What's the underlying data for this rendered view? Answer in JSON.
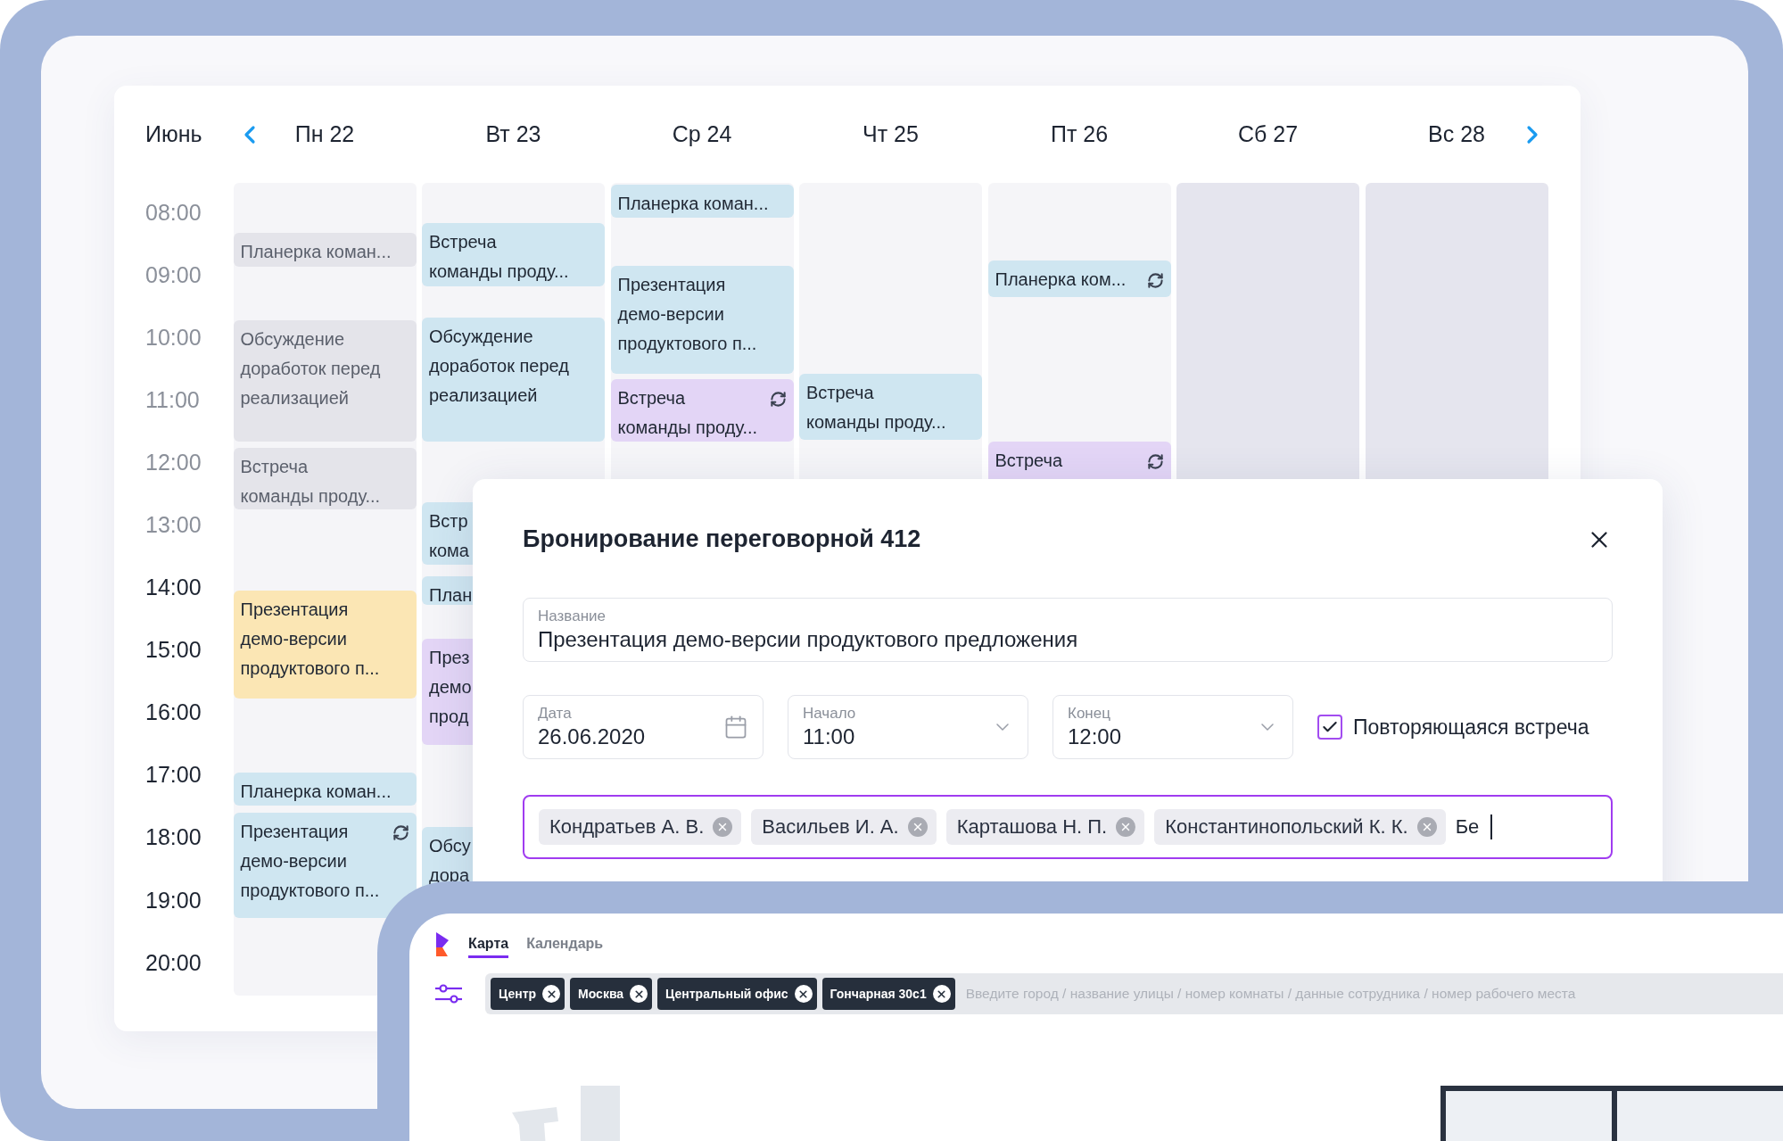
{
  "calendar": {
    "month": "Июнь",
    "days": [
      {
        "label": "Пн 22",
        "weekend": false,
        "events": [
          {
            "lines": [
              "Планерка коман..."
            ],
            "color": "#e4e4ea",
            "recurring": false
          },
          {
            "lines": [
              "Обсуждение",
              "доработок перед",
              "реализацией"
            ],
            "color": "#e4e4ea",
            "recurring": false
          },
          {
            "lines": [
              "Встреча",
              "команды проду..."
            ],
            "color": "#e4e4ea",
            "recurring": false
          },
          {
            "lines": [
              "Презентация",
              "демо-версии",
              "продуктового п..."
            ],
            "color": "#fbe6b4",
            "recurring": false
          },
          {
            "lines": [
              "Планерка коман..."
            ],
            "color": "#cfe6f1",
            "recurring": false
          },
          {
            "lines": [
              "Презентация",
              "демо-версии",
              "продуктового п..."
            ],
            "color": "#cfe6f1",
            "recurring": true
          }
        ]
      },
      {
        "label": "Вт 23",
        "weekend": false,
        "events": [
          {
            "lines": [
              "Встреча",
              "команды проду..."
            ],
            "color": "#cfe6f1",
            "recurring": false
          },
          {
            "lines": [
              "Обсуждение",
              "доработок перед",
              "реализацией"
            ],
            "color": "#cfe6f1",
            "recurring": false
          },
          {
            "lines": [
              "Встр",
              "кома"
            ],
            "color": "#cfe6f1"
          },
          {
            "lines": [
              "План"
            ],
            "color": "#cfe6f1"
          },
          {
            "lines": [
              "През",
              "демо",
              "прод"
            ],
            "color": "#e3d5f6"
          },
          {
            "lines": [
              "Обсу",
              "дора"
            ],
            "color": "#cfe6f1"
          }
        ]
      },
      {
        "label": "Ср 24",
        "weekend": false,
        "events": [
          {
            "lines": [
              "Планерка коман..."
            ],
            "color": "#cfe6f1",
            "recurring": false
          },
          {
            "lines": [
              "Презентация",
              "демо-версии",
              "продуктового п..."
            ],
            "color": "#cfe6f1",
            "recurring": false
          },
          {
            "lines": [
              "Встреча",
              "команды проду..."
            ],
            "color": "#e3d5f6",
            "recurring": true
          }
        ]
      },
      {
        "label": "Чт 25",
        "weekend": false,
        "events": [
          {
            "lines": [
              "Встреча",
              "команды проду..."
            ],
            "color": "#cfe6f1",
            "recurring": false
          }
        ]
      },
      {
        "label": "Пт 26",
        "weekend": false,
        "events": [
          {
            "lines": [
              "Планерка ком..."
            ],
            "color": "#cfe6f1",
            "recurring": true
          },
          {
            "lines": [
              "Встреча"
            ],
            "color": "#e3d5f6",
            "recurring": true
          }
        ]
      },
      {
        "label": "Сб 27",
        "weekend": true
      },
      {
        "label": "Вс 28",
        "weekend": true
      }
    ],
    "times": [
      "08:00",
      "09:00",
      "10:00",
      "11:00",
      "12:00",
      "13:00",
      "14:00",
      "15:00",
      "16:00",
      "17:00",
      "18:00",
      "19:00",
      "20:00"
    ]
  },
  "booking_dialog": {
    "title": "Бронирование переговорной 412",
    "name_field": {
      "label": "Название",
      "value": "Презентация демо-версии продуктового предложения"
    },
    "date_field": {
      "label": "Дата",
      "value": "26.06.2020"
    },
    "start_field": {
      "label": "Начало",
      "value": "11:00"
    },
    "end_field": {
      "label": "Конец",
      "value": "12:00"
    },
    "recurring": {
      "label": "Повторяющаяся встреча",
      "checked": true
    },
    "participants": [
      {
        "name": "Кондратьев А. В."
      },
      {
        "name": "Васильев И. А."
      },
      {
        "name": "Карташова Н. П."
      },
      {
        "name": "Константинопольский К. К."
      }
    ],
    "participants_input": {
      "value": "Бе"
    }
  },
  "map_app": {
    "tabs": [
      {
        "label": "Карта",
        "selected": true
      },
      {
        "label": "Календарь",
        "selected": false
      }
    ],
    "filter_chips": [
      {
        "label": "Центр"
      },
      {
        "label": "Москва"
      },
      {
        "label": "Центральный офис"
      },
      {
        "label": "Гончарная 30с1"
      }
    ],
    "search": {
      "placeholder": "Введите город / название улицы / номер комнаты / данные сотрудника / номер рабочего места"
    }
  }
}
